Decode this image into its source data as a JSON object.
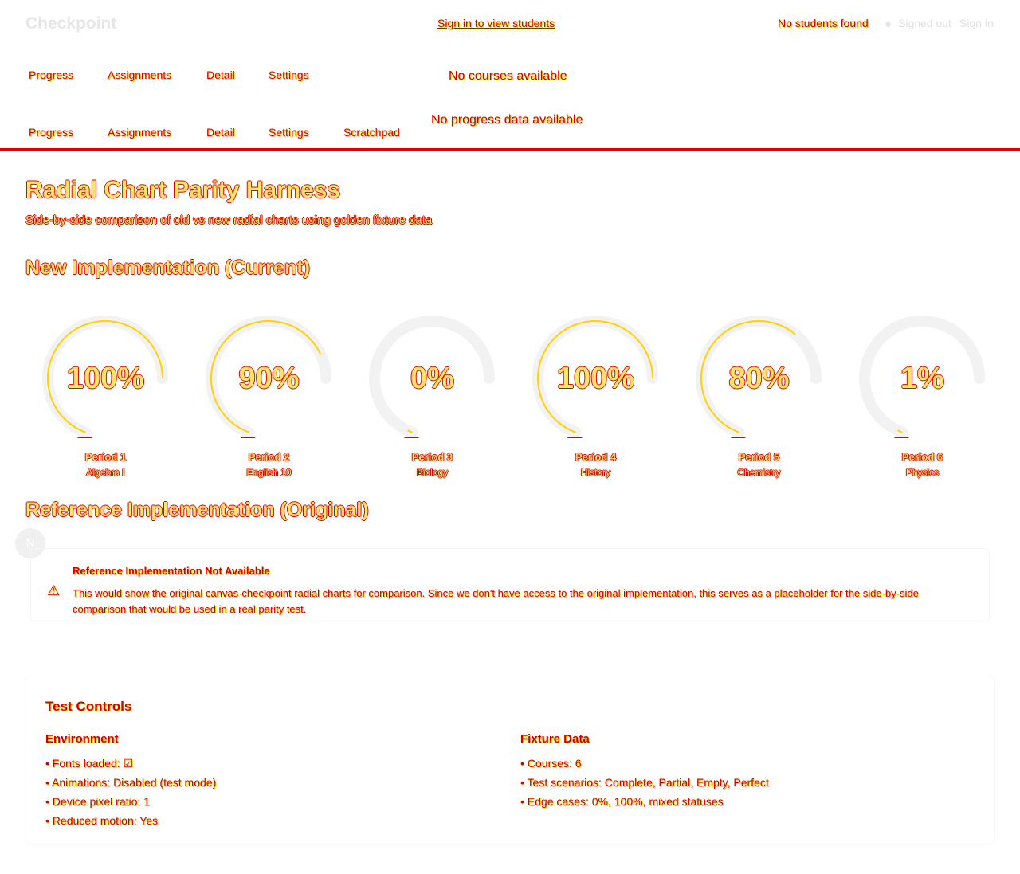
{
  "header": {
    "logo": "Checkpoint",
    "signin_link": "Sign in to view students",
    "no_students": "No students found",
    "signed_out": "Signed out",
    "sign_in": "Sign in"
  },
  "nav1": {
    "items": [
      "Progress",
      "Assignments",
      "Detail",
      "Settings"
    ],
    "message": "No courses available"
  },
  "nav2": {
    "items": [
      "Progress",
      "Assignments",
      "Detail",
      "Settings",
      "Scratchpad"
    ],
    "message": "No progress data available"
  },
  "page": {
    "title": "Radial Chart Parity Harness",
    "subtitle": "Side-by-side comparison of old vs new radial charts using golden fixture data",
    "new_section": "New Implementation (Current)",
    "ref_section": "Reference Implementation (Original)"
  },
  "radials": [
    {
      "percent_label": "100%",
      "value": 100,
      "period": "Period 1",
      "course": "Algebra I"
    },
    {
      "percent_label": "90%",
      "value": 90,
      "period": "Period 2",
      "course": "English 10"
    },
    {
      "percent_label": "0%",
      "value": 0,
      "period": "Period 3",
      "course": "Biology"
    },
    {
      "percent_label": "100%",
      "value": 100,
      "period": "Period 4",
      "course": "History"
    },
    {
      "percent_label": "80%",
      "value": 80,
      "period": "Period 5",
      "course": "Chemistry"
    },
    {
      "percent_label": "1%",
      "value": 1,
      "period": "Period 6",
      "course": "Physics"
    }
  ],
  "avatar_initial": "N",
  "reference_box": {
    "icon": "warning-icon",
    "title": "Reference Implementation Not Available",
    "text": "This would show the original canvas-checkpoint radial charts for comparison. Since we don't have access to the original implementation, this serves as a placeholder for the side-by-side comparison that would be used in a real parity test."
  },
  "controls": {
    "title": "Test Controls",
    "environment_title": "Environment",
    "environment": [
      "Fonts loaded: ☑",
      "Animations: Disabled (test mode)",
      "Device pixel ratio: 1",
      "Reduced motion: Yes"
    ],
    "fixture_title": "Fixture Data",
    "fixture": [
      "Courses: 6",
      "Test scenarios: Complete, Partial, Empty, Perfect",
      "Edge cases: 0%, 100%, mixed statuses"
    ]
  },
  "colors": {
    "accent_red": "#e00000",
    "accent_yellow": "#ffe36a"
  }
}
